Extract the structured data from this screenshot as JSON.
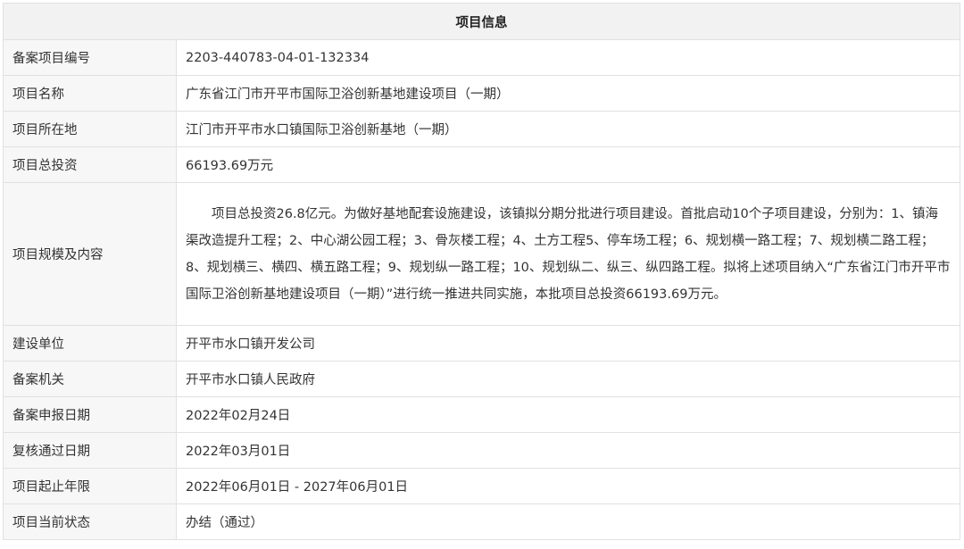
{
  "table": {
    "title": "项目信息",
    "rows": [
      {
        "label": "备案项目编号",
        "value": "2203-440783-04-01-132334"
      },
      {
        "label": "项目名称",
        "value": "广东省江门市开平市国际卫浴创新基地建设项目（一期）"
      },
      {
        "label": "项目所在地",
        "value": "江门市开平市水口镇国际卫浴创新基地（一期）"
      },
      {
        "label": "项目总投资",
        "value": "66193.69万元"
      },
      {
        "label": "项目规模及内容",
        "value": "项目总投资26.8亿元。为做好基地配套设施建设，该镇拟分期分批进行项目建设。首批启动10个子项目建设，分别为：1、镇海渠改造提升工程；2、中心湖公园工程；3、骨灰楼工程；4、土方工程5、停车场工程；6、规划横一路工程；7、规划横二路工程；8、规划横三、横四、横五路工程；9、规划纵一路工程；10、规划纵二、纵三、纵四路工程。拟将上述项目纳入“广东省江门市开平市国际卫浴创新基地建设项目（一期）”进行统一推进共同实施，本批项目总投资66193.69万元。"
      },
      {
        "label": "建设单位",
        "value": "开平市水口镇开发公司"
      },
      {
        "label": "备案机关",
        "value": "开平市水口镇人民政府"
      },
      {
        "label": "备案申报日期",
        "value": "2022年02月24日"
      },
      {
        "label": "复核通过日期",
        "value": "2022年03月01日"
      },
      {
        "label": "项目起止年限",
        "value": "2022年06月01日 - 2027年06月01日"
      },
      {
        "label": "项目当前状态",
        "value": "办结（通过）"
      }
    ]
  }
}
